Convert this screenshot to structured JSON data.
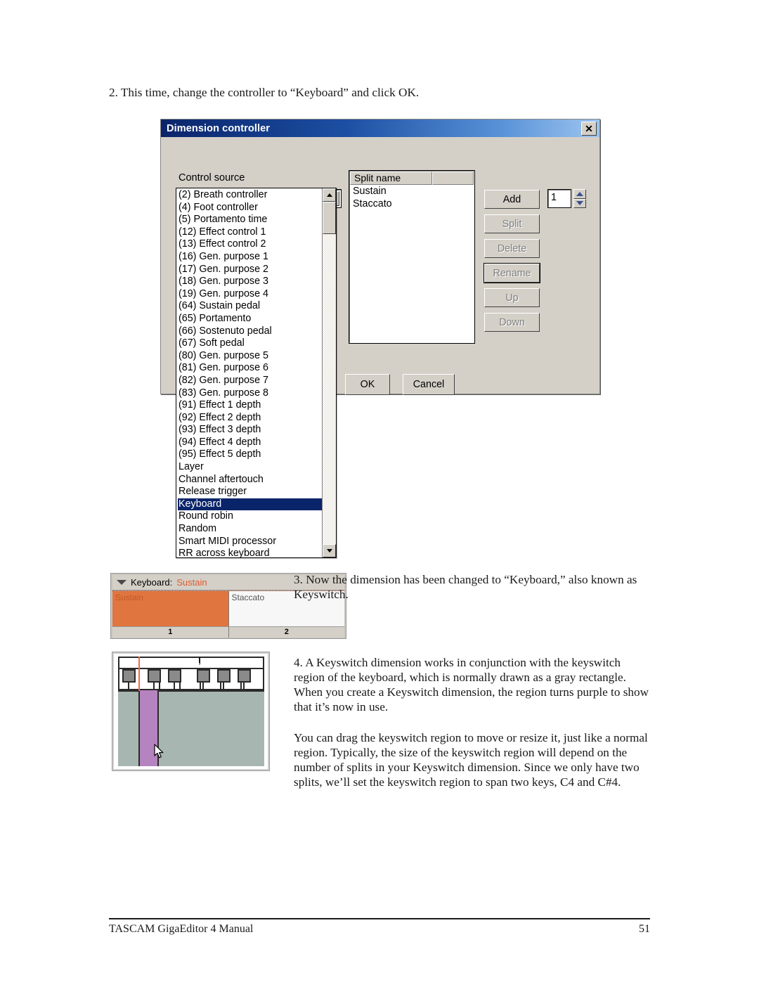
{
  "document": {
    "step2_text": "2. This time, change the controller to “Keyboard” and click OK.",
    "step3_text": "3. Now the dimension has been changed to “Keyboard,” also known as Keyswitch.",
    "step4_text": "4. A Keyswitch dimension works in conjunction with the keyswitch region of the keyboard, which is normally drawn as a gray rectangle.  When you create a Keyswitch dimension, the region turns purple to show that it’s now in use.",
    "step4_text_b": "You can drag the keyswitch region to move or resize it, just like a normal region.  Typically, the size of the keyswitch region will depend on the number of splits in your Keyswitch dimension.  Since we only have two splits, we’ll set the keyswitch region to span two keys, C4 and C#4.",
    "footer_left": "TASCAM GigaEditor 4 Manual",
    "footer_page": "51"
  },
  "dialog": {
    "title": "Dimension controller",
    "close_label": "✕",
    "control_source_label": "Control source",
    "combo_selected_value": "(64) Sustain pedal",
    "dropdown_items": [
      "(2) Breath controller",
      "(4) Foot controller",
      "(5) Portamento time",
      "(12) Effect control 1",
      "(13) Effect control 2",
      "(16) Gen. purpose 1",
      "(17) Gen. purpose 2",
      "(18) Gen. purpose 3",
      "(19) Gen. purpose 4",
      "(64) Sustain pedal",
      "(65) Portamento",
      "(66) Sostenuto pedal",
      "(67) Soft pedal",
      "(80) Gen. purpose 5",
      "(81) Gen. purpose 6",
      "(82) Gen. purpose 7",
      "(83) Gen. purpose 8",
      "(91) Effect 1 depth",
      "(92) Effect 2 depth",
      "(93) Effect 3 depth",
      "(94) Effect 4 depth",
      "(95) Effect 5 depth",
      "Layer",
      "Channel aftertouch",
      "Release trigger",
      "Keyboard",
      "Round robin",
      "Random",
      "Smart MIDI processor",
      "RR across keyboard"
    ],
    "dropdown_highlighted": "Keyboard",
    "split_list": {
      "column_header": "Split name",
      "rows": [
        "Sustain",
        "Staccato"
      ]
    },
    "buttons": {
      "add": "Add",
      "split": "Split",
      "delete": "Delete",
      "rename": "Rename",
      "up": "Up",
      "down": "Down",
      "ok": "OK",
      "cancel": "Cancel"
    },
    "spinner_value": "1"
  },
  "dimension_widget": {
    "label": "Keyboard:",
    "value": "Sustain",
    "cells": [
      {
        "name": "Sustain",
        "index": "1",
        "active": true
      },
      {
        "name": "Staccato",
        "index": "2",
        "active": false
      }
    ]
  },
  "colors": {
    "titlebar_start": "#0a246a",
    "titlebar_end": "#9dc4ef",
    "dialog_face": "#d4d0c8",
    "selection_blue": "#0a246a",
    "dimension_active": "#e0753f",
    "dimension_value_text": "#e05a2b",
    "keyswitch_purple": "#b583bf",
    "keyboard_gray": "#a8b6b2",
    "red_playhead": "#f0694a"
  }
}
